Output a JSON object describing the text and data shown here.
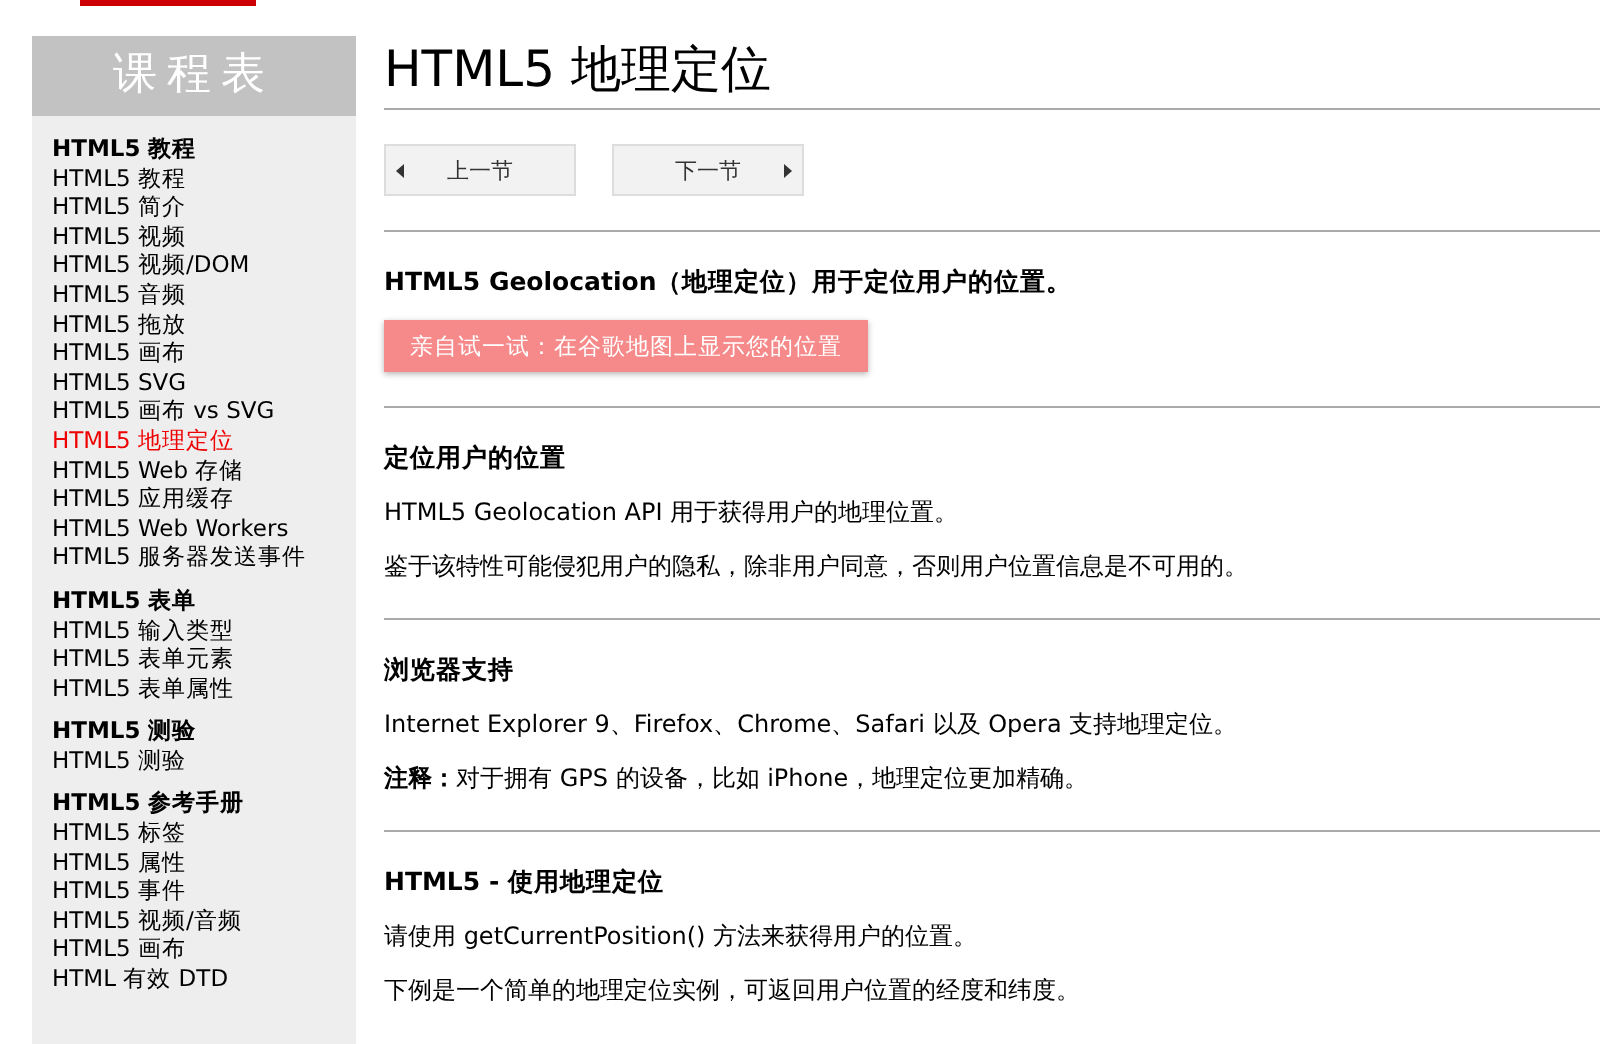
{
  "sidebar": {
    "title": "课程表",
    "groups": [
      {
        "title": "HTML5 教程",
        "items": [
          {
            "label": "HTML5 教程",
            "selected": false
          },
          {
            "label": "HTML5 简介",
            "selected": false
          },
          {
            "label": "HTML5 视频",
            "selected": false
          },
          {
            "label": "HTML5 视频/DOM",
            "selected": false
          },
          {
            "label": "HTML5 音频",
            "selected": false
          },
          {
            "label": "HTML5 拖放",
            "selected": false
          },
          {
            "label": "HTML5 画布",
            "selected": false
          },
          {
            "label": "HTML5 SVG",
            "selected": false
          },
          {
            "label": "HTML5 画布 vs SVG",
            "selected": false
          },
          {
            "label": "HTML5 地理定位",
            "selected": true
          },
          {
            "label": "HTML5 Web 存储",
            "selected": false
          },
          {
            "label": "HTML5 应用缓存",
            "selected": false
          },
          {
            "label": "HTML5 Web Workers",
            "selected": false
          },
          {
            "label": "HTML5 服务器发送事件",
            "selected": false
          }
        ]
      },
      {
        "title": "HTML5 表单",
        "items": [
          {
            "label": "HTML5 输入类型",
            "selected": false
          },
          {
            "label": "HTML5 表单元素",
            "selected": false
          },
          {
            "label": "HTML5 表单属性",
            "selected": false
          }
        ]
      },
      {
        "title": "HTML5 测验",
        "items": [
          {
            "label": "HTML5 测验",
            "selected": false
          }
        ]
      },
      {
        "title": "HTML5 参考手册",
        "items": [
          {
            "label": "HTML5 标签",
            "selected": false
          },
          {
            "label": "HTML5 属性",
            "selected": false
          },
          {
            "label": "HTML5 事件",
            "selected": false
          },
          {
            "label": "HTML5 视频/音频",
            "selected": false
          },
          {
            "label": "HTML5 画布",
            "selected": false
          },
          {
            "label": "HTML 有效 DTD",
            "selected": false
          }
        ]
      }
    ]
  },
  "page": {
    "title": "HTML5 地理定位",
    "prev_button": "上一节",
    "next_button": "下一节",
    "sections": [
      {
        "heading": "HTML5 Geolocation（地理定位）用于定位用户的位置。",
        "try_button": "亲自试一试：在谷歌地图上显示您的位置"
      },
      {
        "heading": "定位用户的位置",
        "paragraphs": [
          "HTML5 Geolocation API 用于获得用户的地理位置。",
          "鉴于该特性可能侵犯用户的隐私，除非用户同意，否则用户位置信息是不可用的。"
        ]
      },
      {
        "heading": "浏览器支持",
        "paragraphs": [
          "Internet Explorer 9、Firefox、Chrome、Safari 以及 Opera 支持地理定位。",
          "**注释：**对于拥有 GPS 的设备，比如 iPhone，地理定位更加精确。"
        ]
      },
      {
        "heading": "HTML5 - 使用地理定位",
        "paragraphs": [
          "请使用 getCurrentPosition() 方法来获得用户的位置。",
          "下例是一个简单的地理定位实例，可返回用户位置的经度和纬度。"
        ]
      }
    ]
  }
}
